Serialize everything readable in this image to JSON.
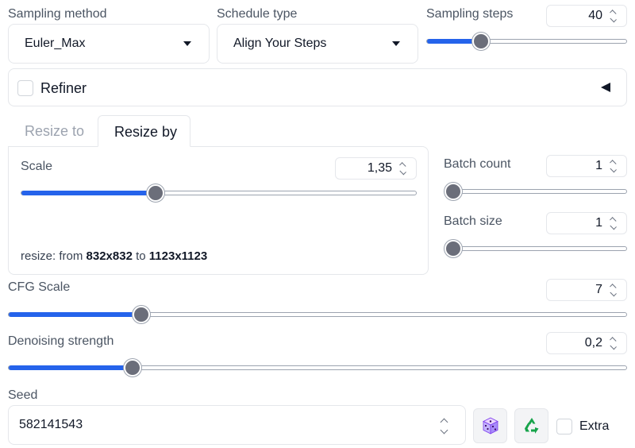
{
  "sampling": {
    "method_label": "Sampling method",
    "method_value": "Euler_Max",
    "schedule_label": "Schedule type",
    "schedule_value": "Align Your Steps",
    "steps_label": "Sampling steps",
    "steps_value": "40",
    "steps_fraction": 0.27
  },
  "refiner": {
    "label": "Refiner",
    "collapse_icon": "triangle-left-icon"
  },
  "tabs": [
    {
      "label": "Resize to",
      "active": false
    },
    {
      "label": "Resize by",
      "active": true
    }
  ],
  "resize": {
    "scale_label": "Scale",
    "scale_value": "1,35",
    "scale_fraction": 0.34,
    "info_prefix": "resize: from ",
    "from_size": "832x832",
    "info_mid": " to ",
    "to_size": "1123x1123"
  },
  "batch": {
    "count_label": "Batch count",
    "count_value": "1",
    "count_fraction": 0.0,
    "size_label": "Batch size",
    "size_value": "1",
    "size_fraction": 0.0
  },
  "cfg": {
    "label": "CFG Scale",
    "value": "7",
    "fraction": 0.215
  },
  "denoise": {
    "label": "Denoising strength",
    "value": "0,2",
    "fraction": 0.2
  },
  "seed": {
    "label": "Seed",
    "value": "582141543",
    "dice_icon": "dice-icon",
    "recycle_icon": "recycle-icon",
    "extra_label": "Extra"
  },
  "colors": {
    "accent": "#2563eb",
    "thumb": "#6b6e7a",
    "border": "#e5e7eb"
  }
}
